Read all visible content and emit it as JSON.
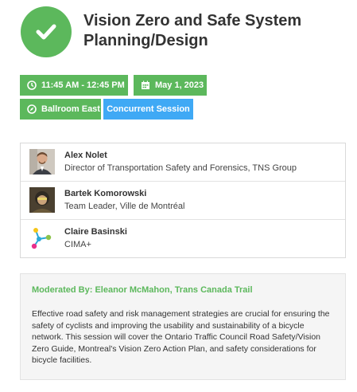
{
  "session": {
    "status_icon": "check-icon",
    "title": "Vision Zero and Safe System Planning/Design",
    "time": "11:45 AM - 12:45 PM",
    "date": "May 1, 2023",
    "room": "Ballroom East",
    "type": "Concurrent Session"
  },
  "speakers": [
    {
      "name": "Alex Nolet",
      "role": "Director of Transportation Safety and Forensics, TNS Group",
      "avatar": "photo"
    },
    {
      "name": "Bartek Komorowski",
      "role": "Team Leader, Ville de Montréal",
      "avatar": "photo"
    },
    {
      "name": "Claire Basinski",
      "role": "CIMA+",
      "avatar": "logo"
    }
  ],
  "moderator": "Moderated By: Eleanor McMahon, Trans Canada Trail",
  "description": "Effective road safety and risk management strategies are crucial for ensuring the safety of cyclists and improving the usability and sustainability of a bicycle network. This session will cover the Ontario Traffic Council Road Safety/Vision Zero Guide, Montreal's Vision Zero Action Plan, and safety considerations for bicycle facilities.",
  "colors": {
    "green": "#5cb85c",
    "blue": "#3fa9f5"
  }
}
